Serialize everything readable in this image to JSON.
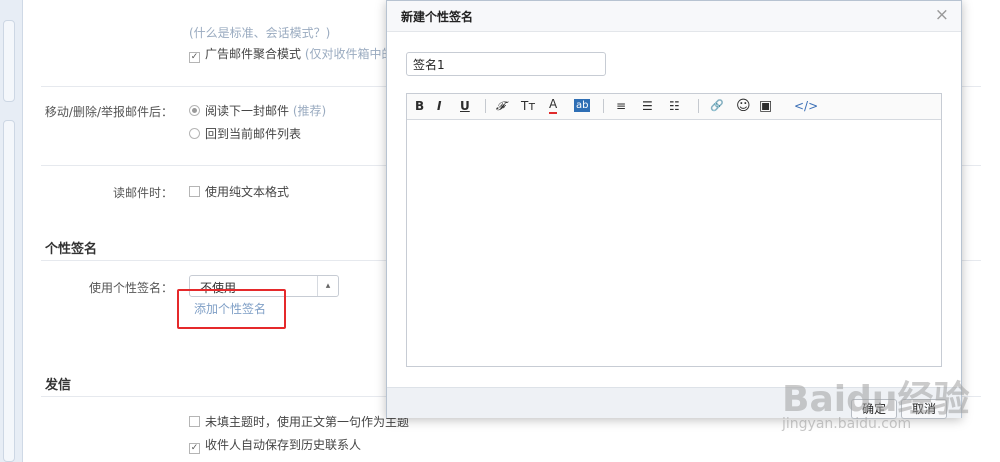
{
  "settings": {
    "mode_hint": "(什么是标准、会话模式？)",
    "ad_merge": {
      "label": "广告邮件聚合模式",
      "hint": "(仅对收件箱中的广",
      "checked": true
    },
    "after_move": {
      "label": "移动/删除/举报邮件后：",
      "opt1": "阅读下一封邮件",
      "opt1_hint": "(推荐)",
      "opt2": "回到当前邮件列表"
    },
    "reading": {
      "label": "读邮件时：",
      "opt": "使用纯文本格式"
    },
    "signature_section": "个性签名",
    "signature": {
      "label": "使用个性签名：",
      "select_value": "不使用",
      "add_link": "添加个性签名"
    },
    "send_section": "发信",
    "send": {
      "opt1": "未填主题时，使用正文第一句作为主题",
      "opt2": "收件人自动保存到历史联系人"
    }
  },
  "dialog": {
    "title": "新建个性签名",
    "close": "×",
    "name_value": "签名1",
    "toolbar": {
      "bold": "B",
      "italic": "I",
      "underline": "U",
      "font": "𝓕",
      "size": "Tт",
      "color": "A",
      "bg": "ab",
      "align": "≡",
      "list_ul": "☰",
      "list_ol": "☷",
      "link": "🔗",
      "emoji": "☺",
      "image": "▣",
      "code": "</>"
    },
    "ok": "确定",
    "cancel": "取消"
  },
  "watermark": {
    "main": "Baidu经验",
    "sub": "jingyan.baidu.com"
  }
}
